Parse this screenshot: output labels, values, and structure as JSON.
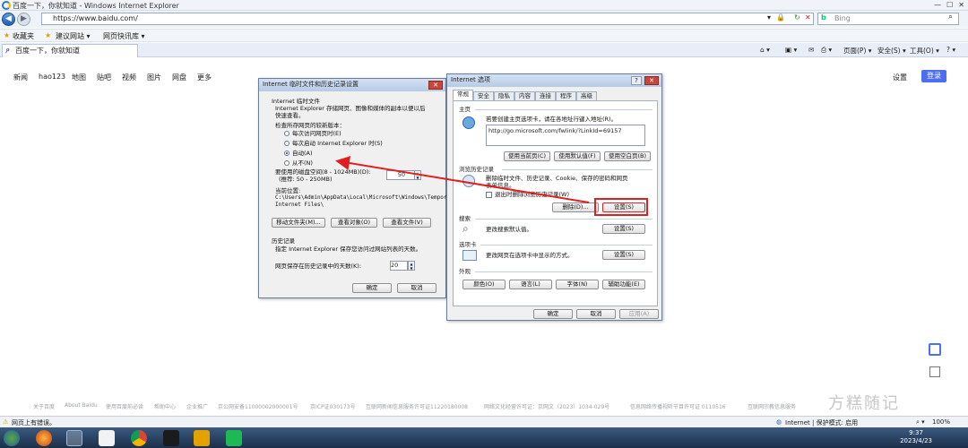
{
  "window": {
    "title": "百度一下，你就知道 - Windows Internet Explorer"
  },
  "address": {
    "url": "https://www.baidu.com/",
    "search_placeholder": "Bing"
  },
  "favorites": {
    "label": "收藏夹",
    "items": [
      "建议网站 ▾",
      "网页快讯库 ▾"
    ]
  },
  "tab": {
    "label": "百度一下，你就知道"
  },
  "commands": [
    "页面(P) ▾",
    "安全(S) ▾",
    "工具(O) ▾"
  ],
  "baidu": {
    "nav": [
      "新闻",
      "hao123",
      "地图",
      "贴吧",
      "视频",
      "图片",
      "网盘",
      "更多"
    ],
    "settings": "设置",
    "login": "登录",
    "footer": [
      "关于百度",
      "About Baidu",
      "使用百度前必读",
      "帮助中心",
      "企业推广",
      "京公网安备11000002000001号",
      "京ICP证030173号",
      "互联网新闻信息服务许可证11220180008",
      "网络文化经营许可证：京网文（2023）1034-029号",
      "信息网络传播视听节目许可证 0110516",
      "互联网宗教信息服务"
    ],
    "watermark": "方糕随记"
  },
  "dlg_temp": {
    "title": "Internet 临时文件和历史记录设置",
    "section1": "Internet 临时文件",
    "desc1": "Internet Explorer 存储网页、图像和媒体的副本以便以后",
    "desc2": "快速查看。",
    "check_label": "检查所存网页的较新版本：",
    "options": [
      "每次访问网页时(E)",
      "每次启动 Internet Explorer 时(S)",
      "自动(A)",
      "从不(N)"
    ],
    "disk_label": "要使用的磁盘空间(8 - 1024MB)(D):",
    "disk_hint": "(推荐: 50 - 250MB)",
    "disk_value": "50",
    "loc_label": "当前位置:",
    "loc_path1": "C:\\Users\\Admin\\AppData\\Local\\Microsoft\\Windows\\Tempor",
    "loc_path2": "Internet Files\\",
    "btn_move": "移动文件夹(M)...",
    "btn_objects": "查看对象(O)",
    "btn_files": "查看文件(V)",
    "history_title": "历史记录",
    "history_desc": "指定 Internet Explorer 保存您访问过网站列表的天数。",
    "days_label": "网页保存在历史记录中的天数(K):",
    "days_value": "20",
    "ok": "确定",
    "cancel": "取消"
  },
  "dlg_opts": {
    "title": "Internet 选项",
    "tabs": [
      "常规",
      "安全",
      "隐私",
      "内容",
      "连接",
      "程序",
      "高级"
    ],
    "home_title": "主页",
    "home_desc": "若要创建主页选项卡，请在各地址行键入地址(R)。",
    "home_url": "http://go.microsoft.com/fwlink/?LinkId=69157",
    "btn_current": "使用当前页(C)",
    "btn_default": "使用默认值(F)",
    "btn_blank": "使用空白页(B)",
    "history_title": "浏览历史记录",
    "history_desc1": "删除临时文件、历史记录、Cookie、保存的密码和网页",
    "history_desc2": "表单信息。",
    "exit_delete": "退出时删除浏览历史记录(W)",
    "btn_delete": "删除(D)...",
    "btn_settings": "设置(S)",
    "search_title": "搜索",
    "search_desc": "更改搜索默认值。",
    "tabs_title": "选项卡",
    "tabs_desc": "更改网页在选项卡中显示的方式。",
    "appearance_title": "外观",
    "btn_colors": "颜色(O)",
    "btn_lang": "语言(L)",
    "btn_fonts": "字体(N)",
    "btn_access": "辅助功能(E)",
    "ok": "确定",
    "cancel": "取消",
    "apply": "应用(A)"
  },
  "statusbar": {
    "left": "网页上有错误。",
    "zone": "Internet | 保护模式: 启用",
    "zoom": "100%"
  },
  "clock": {
    "time": "9:37",
    "date": "2023/4/23"
  },
  "colors": {
    "accent": "#4e6ef2",
    "arrow": "#e02020"
  }
}
